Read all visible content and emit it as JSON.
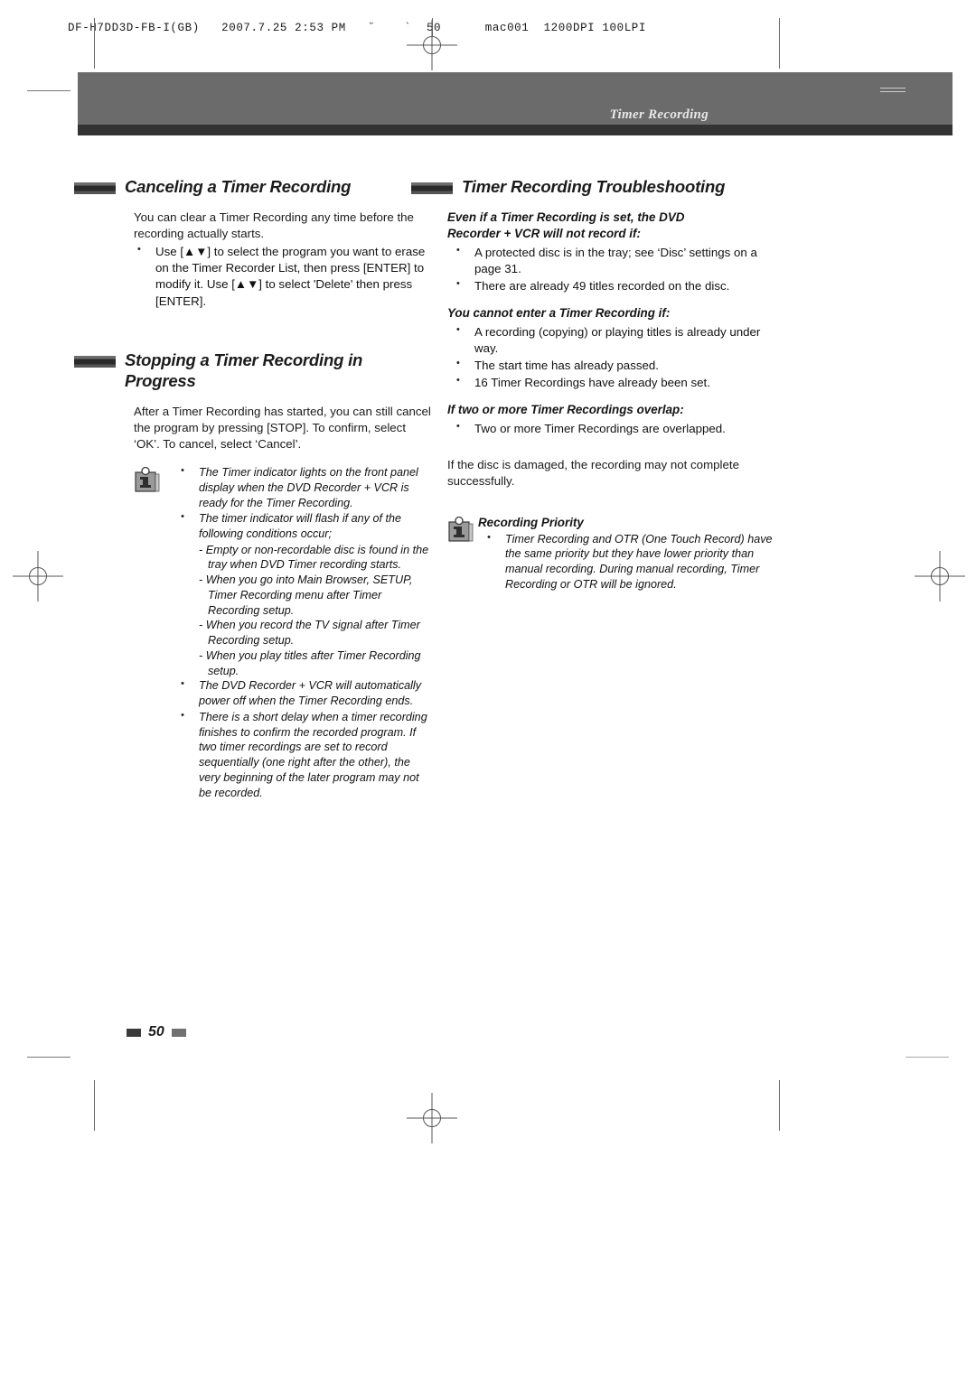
{
  "prepress": {
    "slug": "DF-H7DD3D-FB-I(GB)   2007.7.25 2:53 PM   ˘    ˋ  50      mac001  1200DPI 100LPI"
  },
  "header": {
    "running_title": "Timer Recording"
  },
  "footer": {
    "page_number": "50"
  },
  "left_column": {
    "section1": {
      "title": "Canceling a Timer Recording",
      "intro": "You can clear a Timer Recording any time before the recording actually starts.",
      "bullets": [
        "Use [▲▼] to select the program you want to erase on the Timer Recorder List, then press [ENTER] to modify it. Use [▲▼] to select 'Delete' then press [ENTER]."
      ]
    },
    "section2": {
      "title_line1": "Stopping a Timer Recording in",
      "title_line2": "Progress",
      "intro": "After a Timer Recording has started, you can still cancel the program by pressing [STOP]. To confirm, select ‘OK’. To cancel, select ‘Cancel’.",
      "note": {
        "icon": "info-icon",
        "bullets": [
          "The Timer indicator lights on the front panel display when the DVD Recorder + VCR is ready for the Timer Recording.",
          "The timer indicator will flash if any of the following conditions occur;"
        ],
        "sub_items": [
          "- Empty or non-recordable disc is found in the tray when DVD Timer recording starts.",
          "- When you go into Main Browser, SETUP, Timer Recording menu after Timer Recording setup.",
          "- When you record the TV signal after Timer Recording setup.",
          "- When you play titles after Timer Recording setup."
        ],
        "bullets_after": [
          "The DVD Recorder + VCR will automatically power off when the Timer Recording ends.",
          "There is a short delay when a timer recording finishes to confirm the recorded program. If two timer recordings are set to record sequentially (one right after the other), the very beginning of the later program may not be recorded."
        ]
      }
    }
  },
  "right_column": {
    "section": {
      "title": "Timer Recording Troubleshooting",
      "group1": {
        "subhead_line1": "Even if a Timer Recording is set, the DVD",
        "subhead_line2": "Recorder + VCR will not record if:",
        "bullets": [
          "A protected disc is in the tray; see ‘Disc’ settings on a page 31.",
          "There are already 49 titles recorded on the disc."
        ]
      },
      "group2": {
        "subhead": "You cannot enter a Timer Recording if:",
        "bullets": [
          "A recording (copying) or playing titles is already under way.",
          "The start time has already passed.",
          "16 Timer Recordings have already been set."
        ]
      },
      "group3": {
        "subhead": "If two or more Timer Recordings overlap:",
        "bullets": [
          "Two or more Timer Recordings are overlapped."
        ]
      },
      "closing": "If the disc is damaged, the recording may not complete successfully.",
      "note": {
        "icon": "info-icon",
        "title": "Recording Priority",
        "bullets": [
          "Timer Recording and OTR (One Touch Record) have the same priority but they have lower priority than manual recording. During manual recording, Timer Recording or OTR will be ignored."
        ]
      }
    }
  },
  "colors": {
    "header_band": "#6b6b6b",
    "header_band_foot": "#333333",
    "text": "#1a1a1a"
  }
}
